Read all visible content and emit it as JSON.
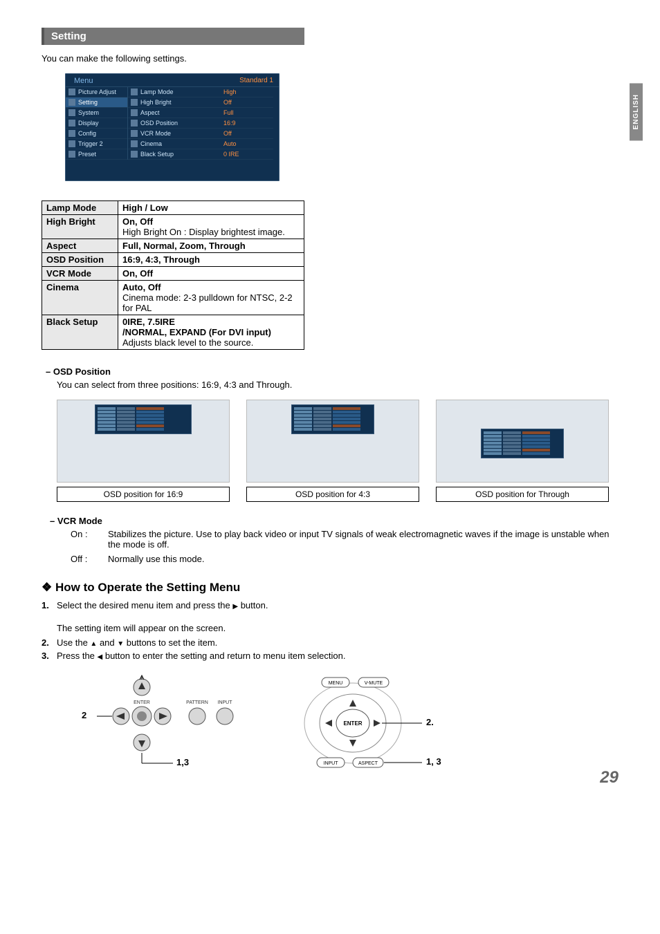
{
  "side_tab": "ENGLISH",
  "section_title": "Setting",
  "intro": "You can make the following settings.",
  "menu": {
    "title": "Menu",
    "standard": "Standard 1",
    "left": [
      "Picture Adjust",
      "Setting",
      "System",
      "Display",
      "Config",
      "Trigger 2",
      "Preset"
    ],
    "mid": [
      "Lamp Mode",
      "High Bright",
      "Aspect",
      "OSD Position",
      "VCR Mode",
      "Cinema",
      "Black Setup"
    ],
    "right": [
      "High",
      "Off",
      "Full",
      "16:9",
      "Off",
      "Auto",
      "0 IRE"
    ]
  },
  "settings_table": [
    {
      "name": "Lamp Mode",
      "value_lines": [
        {
          "bold": true,
          "text": "High / Low"
        }
      ]
    },
    {
      "name": "High Bright",
      "value_lines": [
        {
          "bold": true,
          "text": "On, Off"
        },
        {
          "bold": false,
          "text": "High Bright On : Display brightest image."
        }
      ]
    },
    {
      "name": "Aspect",
      "value_lines": [
        {
          "bold": true,
          "text": "Full, Normal, Zoom, Through"
        }
      ]
    },
    {
      "name": "OSD Position",
      "value_lines": [
        {
          "bold": true,
          "text": "16:9, 4:3, Through"
        }
      ]
    },
    {
      "name": "VCR Mode",
      "value_lines": [
        {
          "bold": true,
          "text": "On, Off"
        }
      ]
    },
    {
      "name": "Cinema",
      "value_lines": [
        {
          "bold": true,
          "text": "Auto, Off"
        },
        {
          "bold": false,
          "text": "Cinema mode: 2-3 pulldown for NTSC, 2-2 for PAL"
        }
      ]
    },
    {
      "name": "Black Setup",
      "value_lines": [
        {
          "bold": true,
          "text": "0IRE, 7.5IRE"
        },
        {
          "bold": true,
          "text": "/NORMAL, EXPAND (For DVI input)"
        },
        {
          "bold": false,
          "text": "Adjusts black level to the source."
        }
      ]
    }
  ],
  "osd_position": {
    "heading": "OSD Position",
    "desc": "You can select from three positions: 16:9, 4:3 and Through.",
    "captions": [
      "OSD position for 16:9",
      "OSD position for 4:3",
      "OSD position for Through"
    ]
  },
  "vcr_mode": {
    "heading": "VCR Mode",
    "on_label": "On :",
    "on_text": "Stabilizes the picture. Use to play back video or input TV signals of weak electromagnetic waves if the image is unstable when the mode is off.",
    "off_label": "Off :",
    "off_text": "Normally use this mode."
  },
  "howto": {
    "title": "How to Operate the Setting Menu",
    "step1_a": "Select the desired menu item and press the ",
    "step1_b": " button.",
    "step1_sub": "The setting item will appear on the screen.",
    "step2_a": "Use the ",
    "step2_b": " and ",
    "step2_c": " buttons to set the item.",
    "step3_a": "Press the ",
    "step3_b": " button to enter the setting and return to menu item selection."
  },
  "remote": {
    "enter": "ENTER",
    "pattern": "PATTERN",
    "input": "INPUT",
    "callout_left": "2",
    "callout_bottom": "1,3"
  },
  "panel": {
    "menu": "MENU",
    "vmute": "V-MUTE",
    "enter": "ENTER",
    "input": "INPUT",
    "aspect": "ASPECT",
    "callout_right1": "2.",
    "callout_right2": "1, 3"
  },
  "page_number": "29"
}
